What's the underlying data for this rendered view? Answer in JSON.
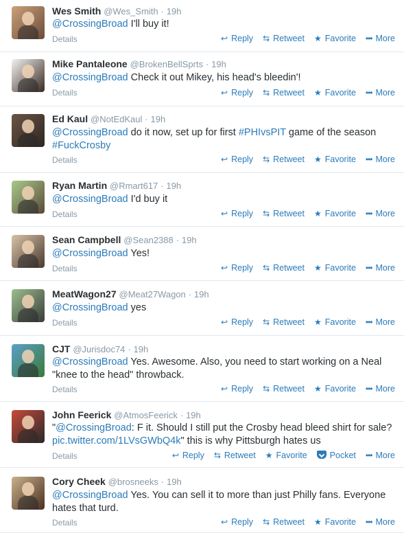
{
  "actions": {
    "reply": "Reply",
    "retweet": "Retweet",
    "favorite": "Favorite",
    "pocket": "Pocket",
    "more": "More",
    "details": "Details"
  },
  "colors": {
    "link": "#2b7bb9",
    "muted": "#8899a6",
    "text": "#292f33"
  },
  "tweets": [
    {
      "name": "Wes Smith",
      "handle": "@Wes_Smith",
      "sep": "·",
      "time": "19h",
      "segments": [
        {
          "t": "@CrossingBroad",
          "link": true
        },
        {
          "t": " I'll buy it!"
        }
      ],
      "avatar_colors": [
        "#c9a27a",
        "#6d4b3a"
      ],
      "pocket": false
    },
    {
      "name": "Mike Pantaleone",
      "handle": "@BrokenBellSprts",
      "sep": "·",
      "time": "19h",
      "segments": [
        {
          "t": "@CrossingBroad",
          "link": true
        },
        {
          "t": " Check it out Mikey, his head's bleedin'!"
        }
      ],
      "avatar_colors": [
        "#f2f2f2",
        "#3a2a20"
      ],
      "pocket": false
    },
    {
      "name": "Ed Kaul",
      "handle": "@NotEdKaul",
      "sep": "·",
      "time": "19h",
      "segments": [
        {
          "t": "@CrossingBroad",
          "link": true
        },
        {
          "t": " do it now, set up for first "
        },
        {
          "t": "#PHIvsPIT",
          "link": true
        },
        {
          "t": " game of the season "
        },
        {
          "t": "#FuckCrosby",
          "link": true
        }
      ],
      "avatar_colors": [
        "#6b5445",
        "#2e2622"
      ],
      "pocket": false
    },
    {
      "name": "Ryan Martin",
      "handle": "@Rmart617",
      "sep": "·",
      "time": "19h",
      "segments": [
        {
          "t": "@CrossingBroad",
          "link": true
        },
        {
          "t": " I'd buy it"
        }
      ],
      "avatar_colors": [
        "#a9c98a",
        "#5a4a3a"
      ],
      "pocket": false
    },
    {
      "name": "Sean Campbell",
      "handle": "@Sean2388",
      "sep": "·",
      "time": "19h",
      "segments": [
        {
          "t": "@CrossingBroad",
          "link": true
        },
        {
          "t": " Yes!"
        }
      ],
      "avatar_colors": [
        "#d8c2a8",
        "#4a3a30"
      ],
      "pocket": false
    },
    {
      "name": "MeatWagon27",
      "handle": "@Meat27Wagon",
      "sep": "·",
      "time": "19h",
      "segments": [
        {
          "t": "@CrossingBroad",
          "link": true
        },
        {
          "t": " yes"
        }
      ],
      "avatar_colors": [
        "#9bbf8e",
        "#3b3b3b"
      ],
      "pocket": false
    },
    {
      "name": "CJT",
      "handle": "@Jurisdoc74",
      "sep": "·",
      "time": "19h",
      "segments": [
        {
          "t": "@CrossingBroad",
          "link": true
        },
        {
          "t": " Yes.  Awesome. Also, you need to start working on a Neal \"knee to the head\" throwback."
        }
      ],
      "avatar_colors": [
        "#5aa0c8",
        "#3c7a3a"
      ],
      "pocket": false
    },
    {
      "name": "John Feerick",
      "handle": "@AtmosFeerick",
      "sep": "·",
      "time": "19h",
      "segments": [
        {
          "t": "\""
        },
        {
          "t": "@CrossingBroad",
          "link": true
        },
        {
          "t": ": F it. Should I still put the Crosby head bleed shirt for sale? "
        },
        {
          "t": "pic.twitter.com/1LVsGWbQ4k",
          "link": true
        },
        {
          "t": "\" this is why Pittsburgh hates us"
        }
      ],
      "avatar_colors": [
        "#c84a3a",
        "#2a2a2a"
      ],
      "pocket": true
    },
    {
      "name": "Cory Cheek",
      "handle": "@brosneeks",
      "sep": "·",
      "time": "19h",
      "segments": [
        {
          "t": "@CrossingBroad",
          "link": true
        },
        {
          "t": " Yes. You can sell it to more than just Philly fans. Everyone hates that turd."
        }
      ],
      "avatar_colors": [
        "#c9b08a",
        "#4a3020"
      ],
      "pocket": false
    }
  ]
}
